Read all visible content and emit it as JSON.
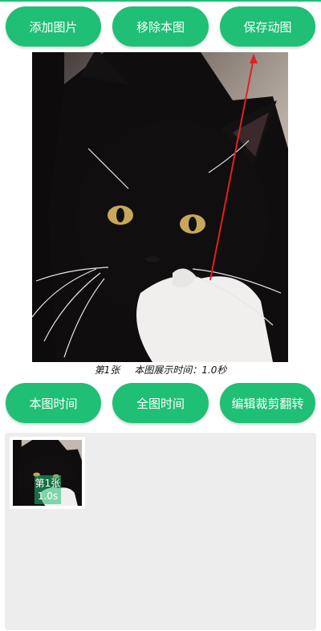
{
  "toolbar_top": {
    "add_image": "添加图片",
    "remove_image": "移除本图",
    "save_animation": "保存动图"
  },
  "preview": {
    "frame_label": "第1张",
    "duration_text": "本图展示时间：1.0秒"
  },
  "toolbar_bottom": {
    "frame_time": "本图时间",
    "all_time": "全图时间",
    "edit_crop_flip": "编辑裁剪翻转"
  },
  "thumbnails": [
    {
      "label": "第1张",
      "duration": "1.0s"
    }
  ],
  "colors": {
    "accent": "#1fbf75",
    "annotation_arrow": "#e02020",
    "panel_bg": "#ededed"
  }
}
